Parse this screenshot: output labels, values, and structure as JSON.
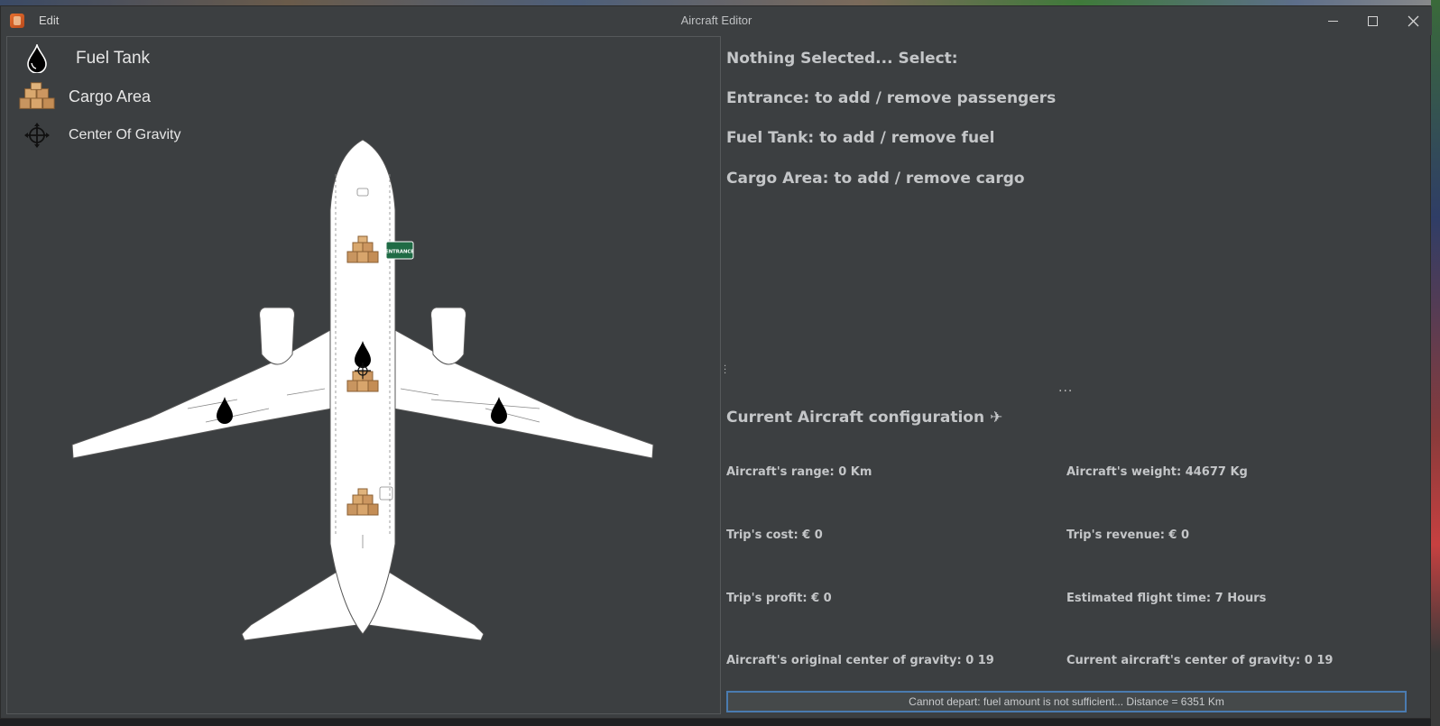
{
  "window": {
    "title": "Aircraft Editor",
    "menu_edit": "Edit"
  },
  "legend": [
    {
      "icon": "fuel-drop-icon",
      "label": "Fuel Tank"
    },
    {
      "icon": "cargo-boxes-icon",
      "label": "Cargo Area"
    },
    {
      "icon": "crosshair-icon",
      "label": "Center Of Gravity"
    }
  ],
  "aircraft": {
    "entrance_sign": "ENTRANCE"
  },
  "instructions": {
    "nothing_selected": "Nothing Selected... Select:",
    "entrance": "Entrance: to add / remove passengers",
    "fuel_tank": "Fuel Tank: to add / remove fuel",
    "cargo_area": "Cargo Area: to add / remove cargo"
  },
  "more": "...",
  "config": {
    "title": "Current Aircraft configuration ✈",
    "range": "Aircraft's range: 0 Km",
    "weight": "Aircraft's weight: 44677 Kg",
    "trip_cost": "Trip's cost: € 0",
    "trip_revenue": "Trip's revenue: € 0",
    "trip_profit": "Trip's profit: € 0",
    "flight_time": "Estimated flight time: 7 Hours",
    "original_cog": "Aircraft's original center of gravity: 0 19",
    "current_cog": "Current aircraft's center of gravity: 0 19"
  },
  "status_message": "Cannot depart: fuel amount is not sufficient... Distance = 6351 Km",
  "colors": {
    "background": "#3c3f41",
    "text": "#c4c6c8",
    "entrance_sign": "#1f6b45",
    "status_border": "#4a7bb0"
  }
}
